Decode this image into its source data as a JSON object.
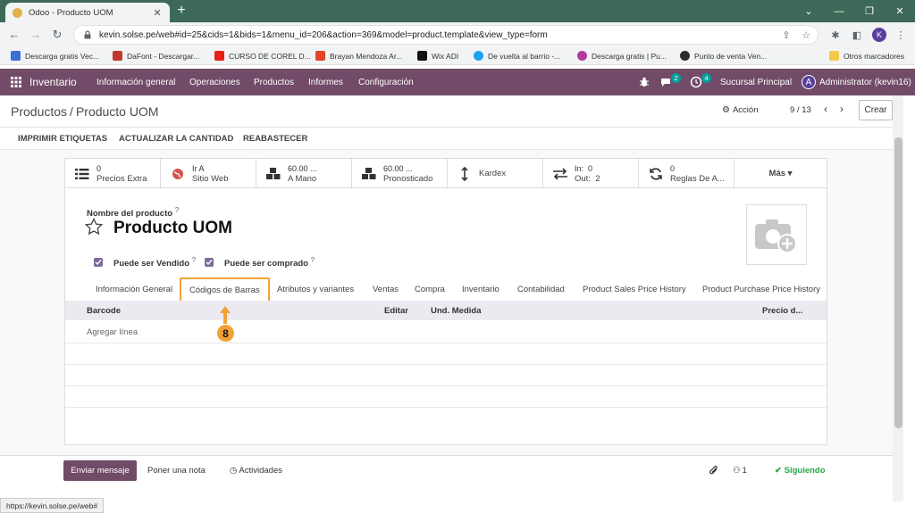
{
  "browser": {
    "tab_title": "Odoo - Producto UOM",
    "url": "kevin.solse.pe/web#id=25&cids=1&bids=1&menu_id=206&action=369&model=product.template&view_type=form",
    "profile_initial": "K",
    "status_url": "https://kevin.solse.pe/web#"
  },
  "bookmarks": [
    {
      "label": "Descarga gratis Vec...",
      "color": "#3b6fd6"
    },
    {
      "label": "DaFont - Descargar...",
      "color": "#c0392b"
    },
    {
      "label": "CURSO DE COREL D...",
      "color": "#e62117"
    },
    {
      "label": "Brayan Mendoza Ar...",
      "color": "#e24329"
    },
    {
      "label": "Wix ADI",
      "color": "#111111"
    },
    {
      "label": "De vuelta al barrio -...",
      "color": "#1da1f2"
    },
    {
      "label": "Descarga gratis | Pu...",
      "color": "#b03a9e"
    },
    {
      "label": "Punto de venta Ven...",
      "color": "#2d2d2d"
    },
    {
      "label": "Otros marcadores",
      "color": "#f2c94c"
    }
  ],
  "navbar": {
    "app_name": "Inventario",
    "menu": [
      "Información general",
      "Operaciones",
      "Productos",
      "Informes",
      "Configuración"
    ],
    "messages_count": "2",
    "activities_count": "4",
    "company": "Sucursal Principal",
    "user_initial": "A",
    "user_name": "Administrator (kevin16)",
    "brand_color": "#714b67"
  },
  "control_panel": {
    "breadcrumb_parent": "Productos",
    "breadcrumb_sep": "/",
    "breadcrumb_current": "Producto UOM",
    "action_label": "Acción",
    "pager": "9 / 13",
    "create_label": "Crear"
  },
  "header_buttons": [
    "IMPRIMIR ETIQUETAS",
    "ACTUALIZAR LA CANTIDAD",
    "REABASTECER"
  ],
  "smart_buttons": [
    {
      "value": "0",
      "label": "Precios Extra",
      "icon": "list-icon"
    },
    {
      "value": "Ir A",
      "label": "Sitio Web",
      "icon": "globe-icon"
    },
    {
      "value": "60.00 ...",
      "label": "A Mano",
      "icon": "cubes-icon"
    },
    {
      "value": "60.00 ...",
      "label": "Pronosticado",
      "icon": "cubes-icon"
    },
    {
      "value": "",
      "label": "Kardex",
      "icon": "updown-arrow-icon"
    },
    {
      "value": "In:  0",
      "label": "Out:  2",
      "icon": "exchange-icon"
    },
    {
      "value": "0",
      "label": "Reglas De A...",
      "icon": "refresh-icon"
    },
    {
      "value": "",
      "label": "Más ▾",
      "icon": ""
    }
  ],
  "form": {
    "name_label": "Nombre del producto",
    "help_mark": "?",
    "product_name": "Producto UOM",
    "can_be_sold_label": "Puede ser Vendido",
    "can_be_purchased_label": "Puede ser comprado",
    "can_be_sold": true,
    "can_be_purchased": true
  },
  "notebook_tabs": [
    "Información General",
    "Códigos de Barras",
    "Atributos y variantes",
    "Ventas",
    "Compra",
    "Inventario",
    "Contabilidad",
    "Product Sales Price History",
    "Product Purchase Price History"
  ],
  "active_tab_index": 1,
  "barcode_table": {
    "columns": [
      "Barcode",
      "Editar",
      "Und. Medida",
      "Precio d..."
    ],
    "add_line": "Agregar línea"
  },
  "annotation": {
    "step_number": "8",
    "color": "#f1a236"
  },
  "chatter": {
    "send_message": "Enviar mensaje",
    "log_note": "Poner una nota",
    "activities": "Actividades",
    "followers_count": "1",
    "following": "Siguiendo"
  }
}
